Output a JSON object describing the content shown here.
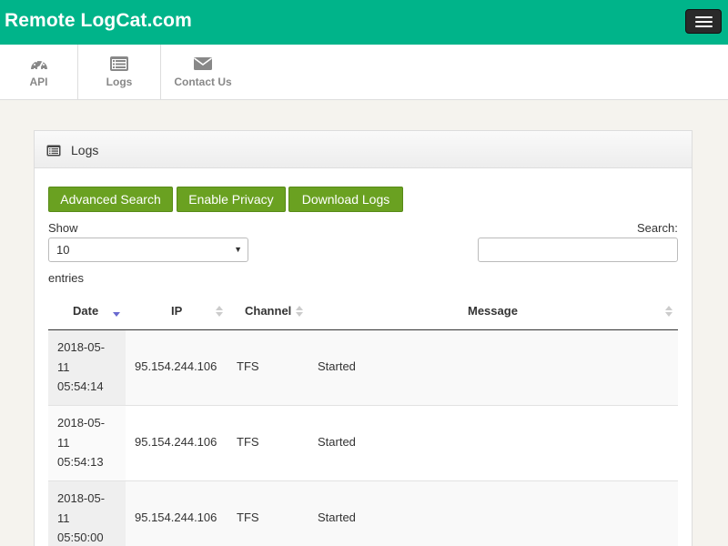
{
  "app": {
    "brand": "Remote LogCat.com",
    "accent": "#00b48a",
    "button_color": "#6aa121"
  },
  "nav": {
    "items": [
      {
        "label": "API",
        "icon": "dashboard-icon"
      },
      {
        "label": "Logs",
        "icon": "list-icon"
      },
      {
        "label": "Contact Us",
        "icon": "envelope-icon"
      }
    ]
  },
  "panel": {
    "title": "Logs",
    "icon": "list-icon"
  },
  "toolbar": {
    "advanced_search": "Advanced Search",
    "enable_privacy": "Enable Privacy",
    "download_logs": "Download Logs"
  },
  "table_controls": {
    "show_label": "Show",
    "page_size": "10",
    "entries_label": "entries",
    "search_label": "Search:",
    "search_value": ""
  },
  "table": {
    "columns": [
      "Date",
      "IP",
      "Channel",
      "Message"
    ],
    "sorted_column": "Date",
    "rows": [
      {
        "date_line1": "2018-05-",
        "date_line2": "11",
        "date_line3": "05:54:14",
        "ip": "95.154.244.106",
        "channel": "TFS",
        "message": "Started"
      },
      {
        "date_line1": "2018-05-",
        "date_line2": "11",
        "date_line3": "05:54:13",
        "ip": "95.154.244.106",
        "channel": "TFS",
        "message": "Started"
      },
      {
        "date_line1": "2018-05-",
        "date_line2": "11",
        "date_line3": "05:50:00",
        "ip": "95.154.244.106",
        "channel": "TFS",
        "message": "Started"
      }
    ]
  }
}
